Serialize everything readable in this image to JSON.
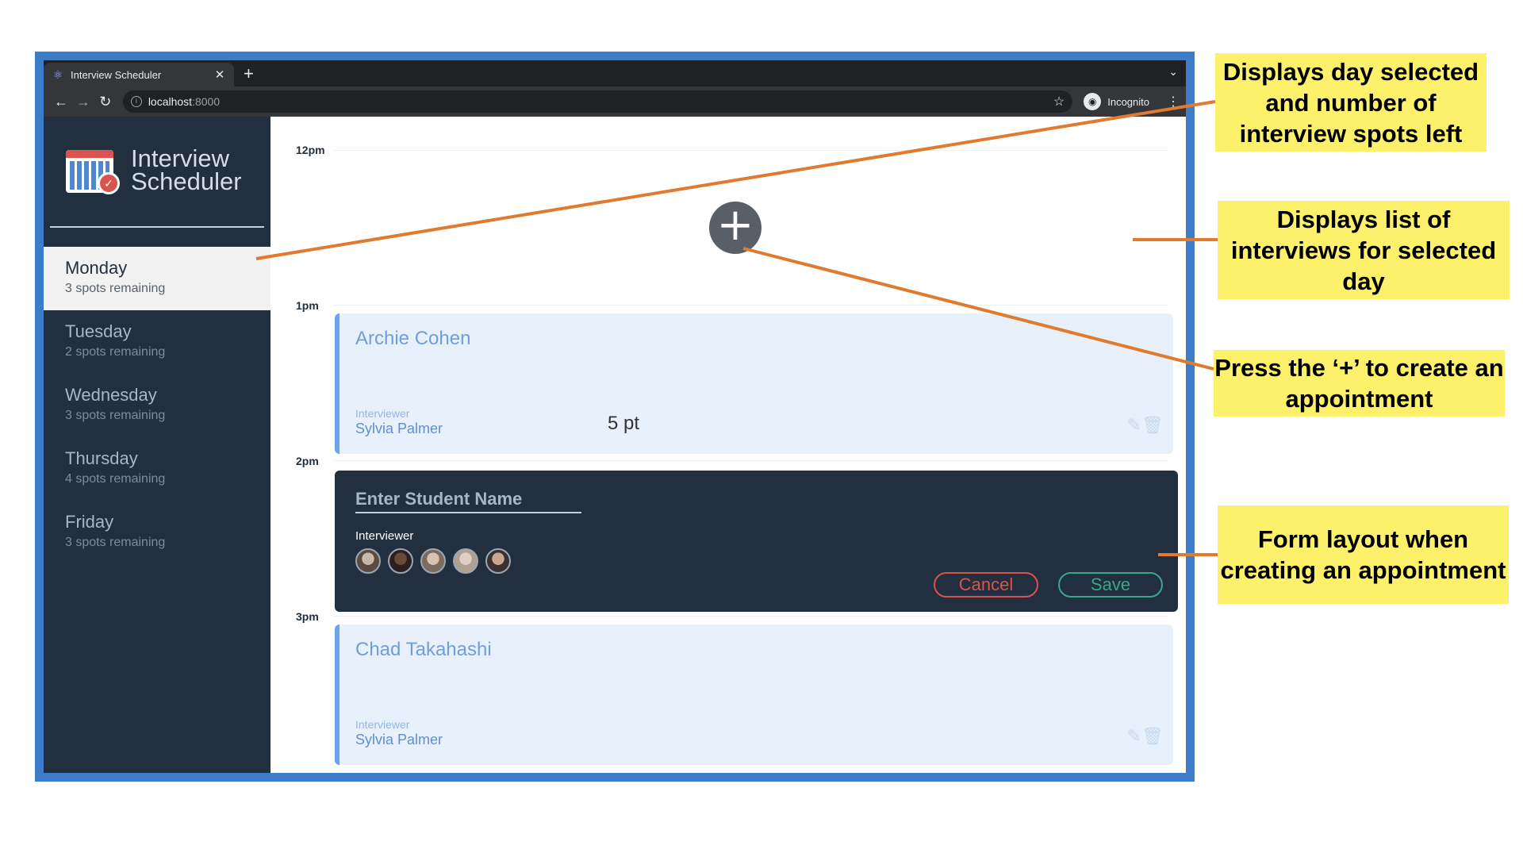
{
  "browser": {
    "tab_title": "Interview Scheduler",
    "url_host": "localhost",
    "url_port": ":8000",
    "incognito_label": "Incognito"
  },
  "app": {
    "logo_line1": "Interview",
    "logo_line2": "Scheduler"
  },
  "days": [
    {
      "name": "Monday",
      "spots": "3 spots remaining",
      "selected": true
    },
    {
      "name": "Tuesday",
      "spots": "2 spots remaining",
      "selected": false
    },
    {
      "name": "Wednesday",
      "spots": "3 spots remaining",
      "selected": false
    },
    {
      "name": "Thursday",
      "spots": "4 spots remaining",
      "selected": false
    },
    {
      "name": "Friday",
      "spots": "3 spots remaining",
      "selected": false
    }
  ],
  "schedule": {
    "times": [
      "12pm",
      "1pm",
      "2pm",
      "3pm"
    ],
    "appointments": [
      {
        "student": "Archie Cohen",
        "interviewer_label": "Interviewer",
        "interviewer": "Sylvia Palmer"
      },
      {
        "student": "Chad Takahashi",
        "interviewer_label": "Interviewer",
        "interviewer": "Sylvia Palmer"
      }
    ],
    "note": "5 pt"
  },
  "form": {
    "placeholder": "Enter Student Name",
    "interviewer_label": "Interviewer",
    "cancel_label": "Cancel",
    "save_label": "Save"
  },
  "annotations": {
    "day_selected": "Displays day selected and number of interview spots left",
    "list_interviews": "Displays list of interviews for selected day",
    "press_plus": "Press the ‘+’ to create an appointment",
    "form_layout": "Form layout when creating an appointment"
  },
  "colors": {
    "frame_blue": "#3d7cc9",
    "sidebar": "#222f3e",
    "callout_yellow": "#fdf06b",
    "arrow_orange": "#e07a2f",
    "cancel_red": "#d9534f",
    "save_green": "#37a98a"
  }
}
